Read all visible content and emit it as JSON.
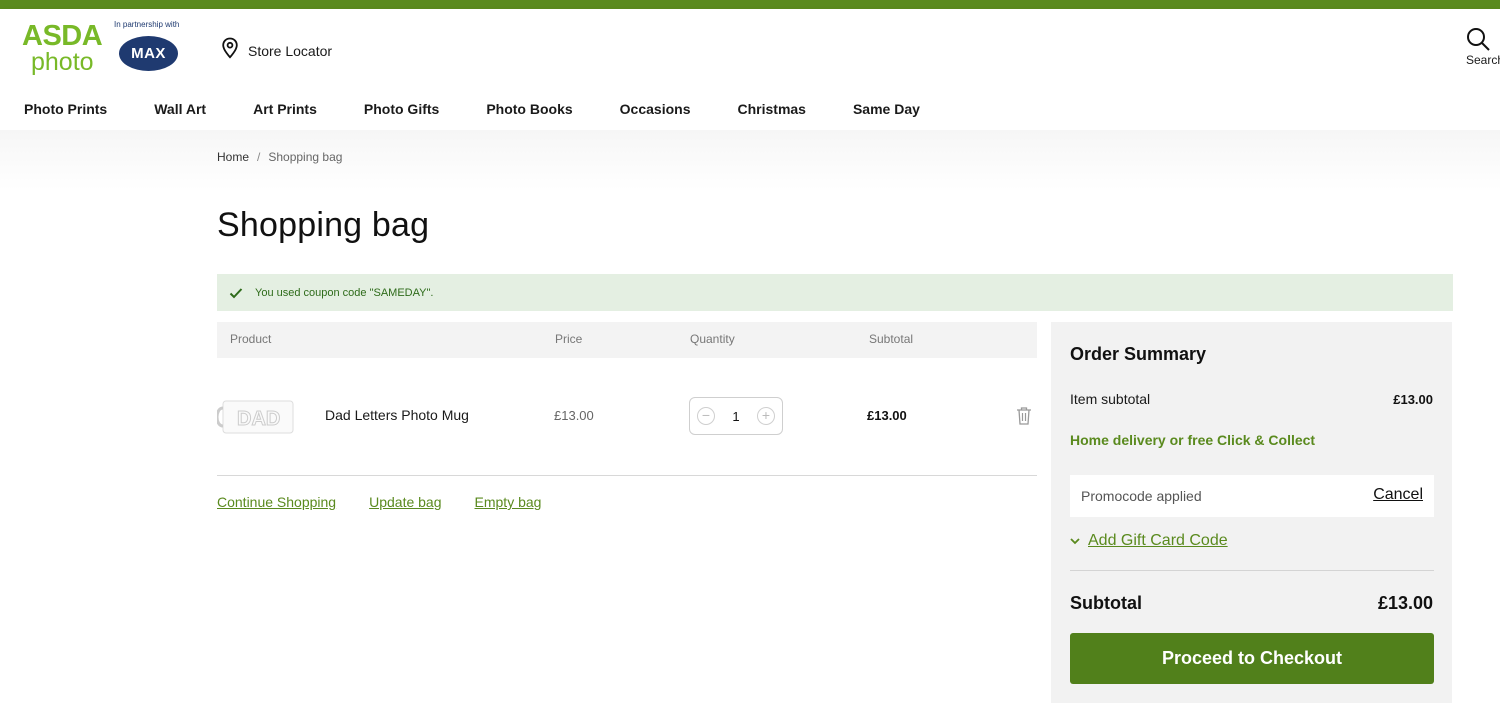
{
  "brand": {
    "logo_top": "ASDA",
    "logo_bottom": "photo",
    "partner_text": "In partnership with",
    "partner_logo": "MAX"
  },
  "header": {
    "store_locator": "Store Locator",
    "search_label": "Search"
  },
  "nav": [
    {
      "label": "Photo Prints"
    },
    {
      "label": "Wall Art"
    },
    {
      "label": "Art Prints"
    },
    {
      "label": "Photo Gifts"
    },
    {
      "label": "Photo Books"
    },
    {
      "label": "Occasions"
    },
    {
      "label": "Christmas"
    },
    {
      "label": "Same Day"
    }
  ],
  "breadcrumb": {
    "home": "Home",
    "separator": "/",
    "current": "Shopping bag"
  },
  "page_title": "Shopping bag",
  "coupon_message": "You used coupon code \"SAMEDAY\".",
  "table": {
    "headers": {
      "product": "Product",
      "price": "Price",
      "quantity": "Quantity",
      "subtotal": "Subtotal"
    },
    "items": [
      {
        "name": "Dad Letters Photo Mug",
        "price": "£13.00",
        "quantity": "1",
        "subtotal": "£13.00"
      }
    ]
  },
  "actions": {
    "continue": "Continue Shopping",
    "update": "Update bag",
    "empty": "Empty bag"
  },
  "summary": {
    "title": "Order Summary",
    "item_subtotal_label": "Item subtotal",
    "item_subtotal_value": "£13.00",
    "delivery_text": "Home delivery or free Click & Collect",
    "promo_label": "Promocode applied",
    "promo_cancel": "Cancel",
    "gift_card": "Add Gift Card Code",
    "subtotal_label": "Subtotal",
    "subtotal_value": "£13.00",
    "checkout_button": "Proceed to Checkout"
  },
  "colors": {
    "brand_green": "#78b928",
    "accent_green": "#5a8a1e",
    "checkout_green": "#51801b",
    "coupon_bg": "#e4efe2",
    "partner_navy": "#1f3a70"
  }
}
